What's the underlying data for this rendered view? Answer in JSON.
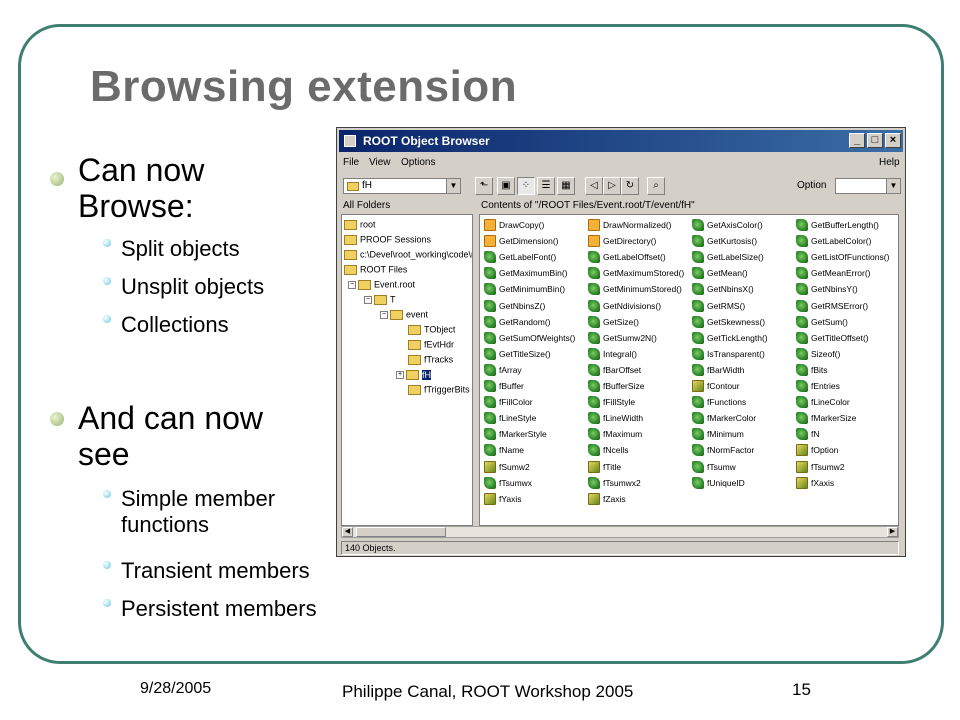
{
  "slide": {
    "title": "Browsing extension",
    "bullets": [
      {
        "text": "Can now Browse:",
        "subs": [
          "Split objects",
          "Unsplit objects",
          "Collections"
        ]
      },
      {
        "text": "And can now see",
        "subs": [
          "Simple member functions",
          "Transient members",
          "Persistent members"
        ]
      }
    ],
    "sub2_0_line1": "Simple member",
    "sub2_0_line2": "functions",
    "b1_line1": "Can now",
    "b1_line2": "Browse:",
    "b2_line1": "And can now",
    "b2_line2": "see"
  },
  "footer": {
    "date": "9/28/2005",
    "center": "Philippe Canal, ROOT Workshop 2005",
    "page": "15"
  },
  "browser": {
    "title": "ROOT Object Browser",
    "menu": [
      "File",
      "View",
      "Options",
      "Help"
    ],
    "combo_value": "fH",
    "option_label": "Option",
    "left_title": "All Folders",
    "contents_title": "Contents of \"/ROOT Files/Event.root/T/event/fH\"",
    "status": "140 Objects.",
    "tree": [
      "root",
      "PROOF Sessions",
      "c:\\Devel\\root_working\\code\\roo",
      "ROOT Files",
      "Event.root",
      "T",
      "event",
      "TObject",
      "fEvtHdr",
      "fTracks",
      "fH",
      "fTriggerBits"
    ],
    "columns": [
      [
        "DrawCopy()",
        "GetDimension()",
        "GetLabelFont()",
        "GetMaximumBin()",
        "GetMinimumBin()",
        "GetNbinsZ()",
        "GetRandom()",
        "GetSumOfWeights()",
        "GetTitleSize()",
        "fArray",
        "fBuffer",
        "fFillColor",
        "fLineStyle",
        "fMarkerStyle",
        "fName",
        "fSumw2",
        "fTsumwx",
        "fYaxis"
      ],
      [
        "DrawNormalized()",
        "GetDirectory()",
        "GetLabelOffset()",
        "GetMaximumStored()",
        "GetMinimumStored()",
        "GetNdivisions()",
        "GetSize()",
        "GetSumw2N()",
        "Integral()",
        "fBarOffset",
        "fBufferSize",
        "fFillStyle",
        "fLineWidth",
        "fMaximum",
        "fNcells",
        "fTitle",
        "fTsumwx2",
        "fZaxis"
      ],
      [
        "GetAxisColor()",
        "GetKurtosis()",
        "GetLabelSize()",
        "GetMean()",
        "GetNbinsX()",
        "GetRMS()",
        "GetSkewness()",
        "GetTickLength()",
        "IsTransparent()",
        "fBarWidth",
        "fContour",
        "fFunctions",
        "fMarkerColor",
        "fMinimum",
        "fNormFactor",
        "fTsumw",
        "fUniqueID",
        ""
      ],
      [
        "GetBufferLength()",
        "GetLabelColor()",
        "GetListOfFunctions()",
        "GetMeanError()",
        "GetNbinsY()",
        "GetRMSError()",
        "GetSum()",
        "GetTitleOffset()",
        "Sizeof()",
        "fBits",
        "fEntries",
        "fLineColor",
        "fMarkerSize",
        "fN",
        "fOption",
        "fTsumw2",
        "fXaxis",
        ""
      ]
    ]
  }
}
